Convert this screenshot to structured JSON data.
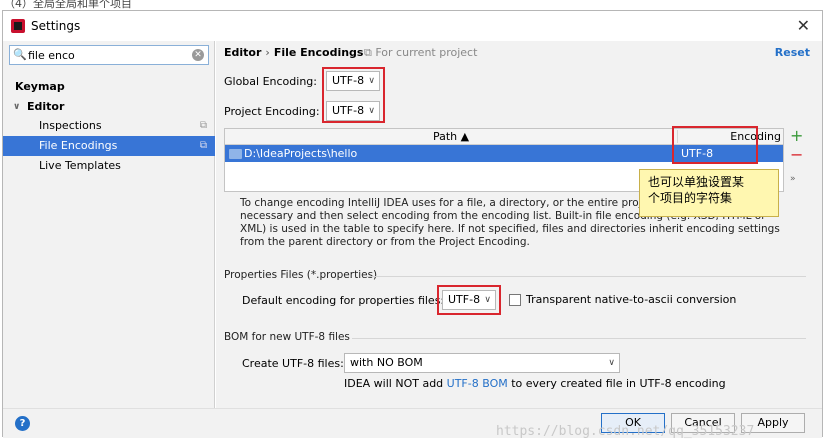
{
  "top_strip_text": "（4）全局全局和单个项目",
  "window": {
    "title": "Settings",
    "close_glyph": "✕"
  },
  "sidebar": {
    "search_value": "file enco",
    "items": [
      {
        "label": "Keymap"
      },
      {
        "label": "Editor",
        "caret": "∨"
      },
      {
        "label": "Inspections"
      },
      {
        "label": "File Encodings"
      },
      {
        "label": "Live Templates"
      }
    ]
  },
  "main": {
    "breadcrumb_parent": "Editor",
    "breadcrumb_sep": "›",
    "breadcrumb_current": "File Encodings",
    "for_project": "For current project",
    "reset_label": "Reset",
    "global_label": "Global Encoding:",
    "global_value": "UTF-8",
    "project_label": "Project Encoding:",
    "project_value": "UTF-8",
    "table": {
      "col_path": "Path ▲",
      "col_encoding": "Encoding",
      "row_path": "D:\\IdeaProjects\\hello",
      "row_encoding": "UTF-8"
    },
    "callout_line1": "也可以单独设置某",
    "callout_line2": "个项目的字符集",
    "info_text": "To change encoding IntelliJ IDEA uses for a file, a directory, or the entire project, add its path if necessary and then select encoding from the encoding list. Built-in file encoding (e.g. XSD, HTML or XML) is used in the table to specify here. If not specified, files and directories inherit encoding settings from the parent directory or from the Project Encoding.",
    "properties_group": "Properties Files (*.properties)",
    "properties_label": "Default encoding for properties files:",
    "properties_value": "UTF-8",
    "transparent_label": "Transparent native-to-ascii conversion",
    "bom_group": "BOM for new UTF-8 files",
    "bom_label": "Create UTF-8 files:",
    "bom_value": "with NO BOM",
    "bom_note_pre": "IDEA will NOT add",
    "bom_note_link": "UTF-8 BOM",
    "bom_note_post": "to every created file in UTF-8 encoding"
  },
  "footer": {
    "help": "?",
    "ok": "OK",
    "cancel": "Cancel",
    "apply": "Apply"
  },
  "watermark": "https://blog.csdn.net/qq_35153237"
}
